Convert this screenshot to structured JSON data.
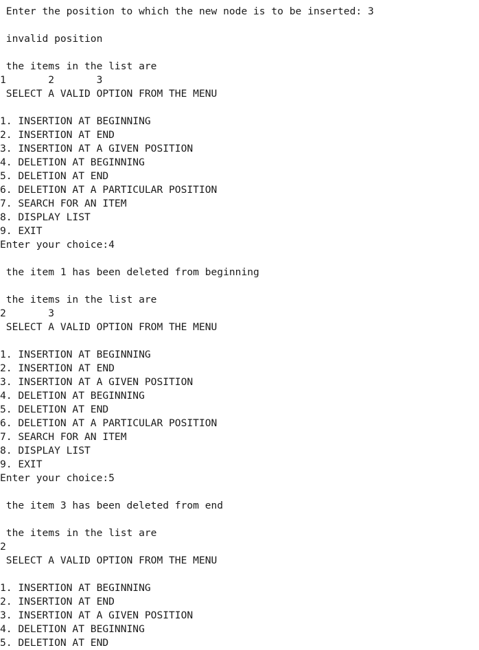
{
  "console": {
    "lines": [
      " Enter the position to which the new node is to be inserted: 3",
      "",
      " invalid position",
      "",
      " the items in the list are",
      "1       2       3",
      " SELECT A VALID OPTION FROM THE MENU",
      "",
      "1. INSERTION AT BEGINNING",
      "2. INSERTION AT END",
      "3. INSERTION AT A GIVEN POSITION",
      "4. DELETION AT BEGINNING",
      "5. DELETION AT END",
      "6. DELETION AT A PARTICULAR POSITION",
      "7. SEARCH FOR AN ITEM",
      "8. DISPLAY LIST",
      "9. EXIT",
      "Enter your choice:4",
      "",
      " the item 1 has been deleted from beginning",
      "",
      " the items in the list are",
      "2       3",
      " SELECT A VALID OPTION FROM THE MENU",
      "",
      "1. INSERTION AT BEGINNING",
      "2. INSERTION AT END",
      "3. INSERTION AT A GIVEN POSITION",
      "4. DELETION AT BEGINNING",
      "5. DELETION AT END",
      "6. DELETION AT A PARTICULAR POSITION",
      "7. SEARCH FOR AN ITEM",
      "8. DISPLAY LIST",
      "9. EXIT",
      "Enter your choice:5",
      "",
      " the item 3 has been deleted from end",
      "",
      " the items in the list are",
      "2",
      " SELECT A VALID OPTION FROM THE MENU",
      "",
      "1. INSERTION AT BEGINNING",
      "2. INSERTION AT END",
      "3. INSERTION AT A GIVEN POSITION",
      "4. DELETION AT BEGINNING",
      "5. DELETION AT END"
    ]
  }
}
